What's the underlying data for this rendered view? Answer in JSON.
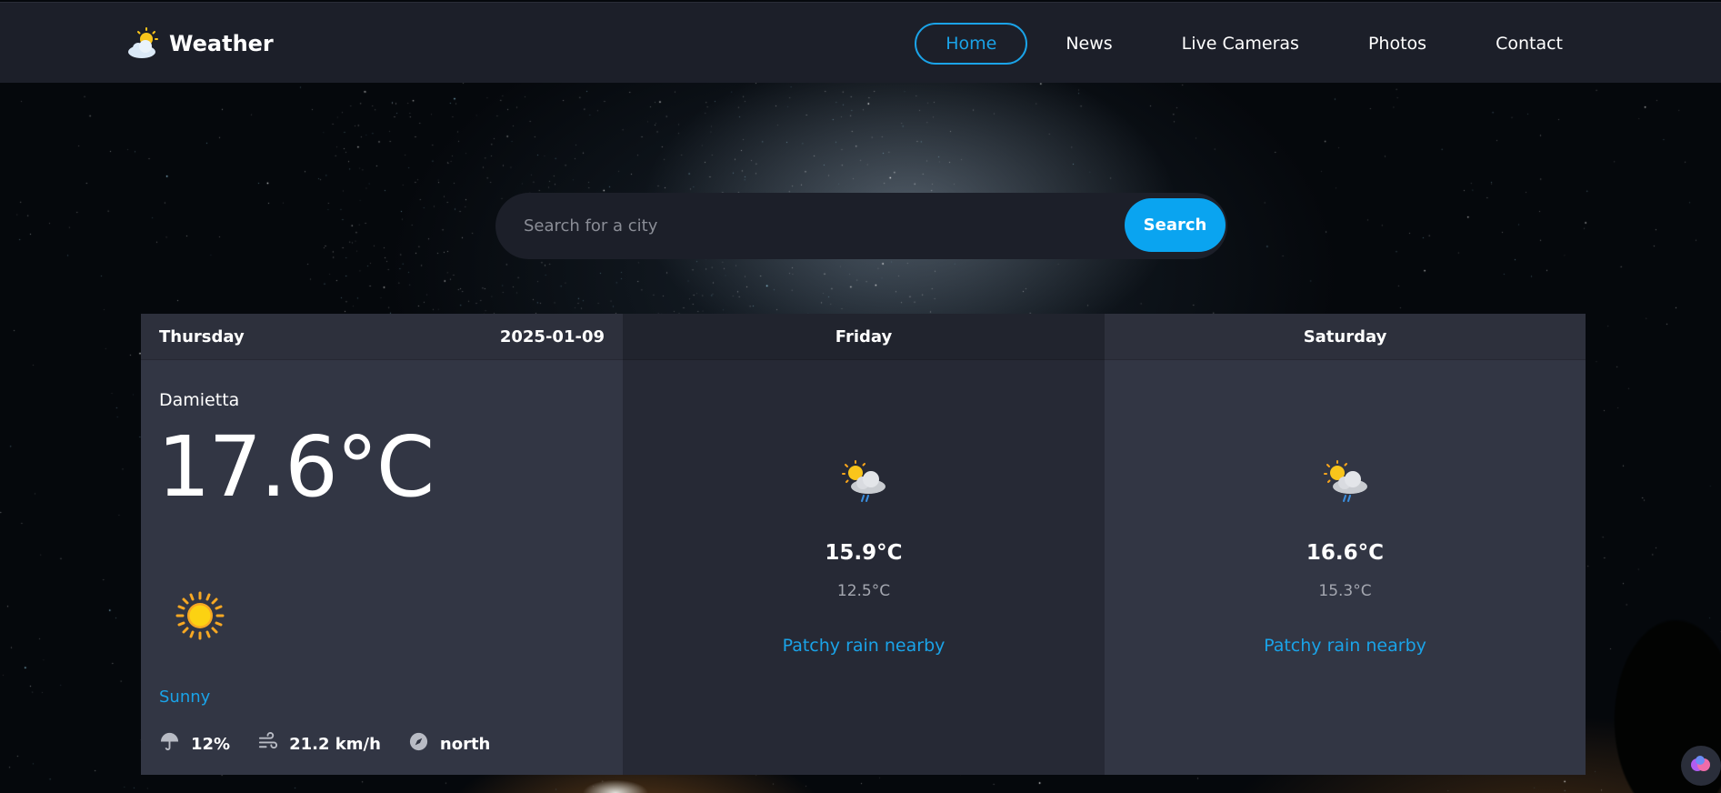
{
  "brand": {
    "name": "Weather",
    "icon": "sun-behind-cloud-icon"
  },
  "nav": {
    "items": [
      {
        "label": "Home",
        "active": true
      },
      {
        "label": "News",
        "active": false
      },
      {
        "label": "Live Cameras",
        "active": false
      },
      {
        "label": "Photos",
        "active": false
      },
      {
        "label": "Contact",
        "active": false
      }
    ]
  },
  "search": {
    "placeholder": "Search for a city",
    "value": "",
    "button_label": "Search"
  },
  "today": {
    "day": "Thursday",
    "date": "2025-01-09",
    "city": "Damietta",
    "temperature": "17.6°C",
    "icon": "sun-icon",
    "condition": "Sunny",
    "rain": "12%",
    "wind": "21.2 km/h",
    "direction": "north"
  },
  "forecast": [
    {
      "day": "Friday",
      "icon": "sun-cloud-rain-icon",
      "max": "15.9°C",
      "min": "12.5°C",
      "condition": "Patchy rain nearby"
    },
    {
      "day": "Saturday",
      "icon": "sun-cloud-rain-icon",
      "max": "16.6°C",
      "min": "15.3°C",
      "condition": "Patchy rain nearby"
    }
  ],
  "colors": {
    "accent": "#0aa4f0",
    "nav_bg": "#1c1f29",
    "card_bg": "#323644",
    "card_alt_bg": "#262935"
  }
}
